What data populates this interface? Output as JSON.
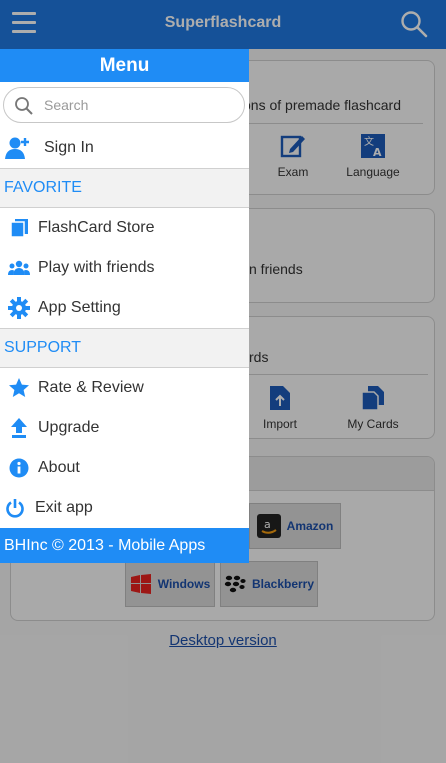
{
  "topbar": {
    "title": "Superflashcard"
  },
  "background": {
    "card1_text": "ons of premade flashcard",
    "card1_buttons": [
      {
        "label": "Exam",
        "icon": "edit-icon"
      },
      {
        "label": "Language",
        "icon": "translate-icon"
      }
    ],
    "card2_text": "n friends",
    "card3_text": "rds",
    "card3_buttons": [
      {
        "label": "Import",
        "icon": "file-upload-icon"
      },
      {
        "label": "My Cards",
        "icon": "cards-icon"
      }
    ],
    "stores": [
      {
        "label": "Amazon",
        "icon": "amazon-icon"
      },
      {
        "label": "Windows",
        "icon": "windows-icon"
      },
      {
        "label": "Blackberry",
        "icon": "blackberry-icon"
      }
    ],
    "desktop_link": "Desktop version"
  },
  "menu": {
    "title": "Menu",
    "search_placeholder": "Search",
    "sign_in": "Sign In",
    "favorite_header": "FAVORITE",
    "favorite_items": [
      {
        "label": "FlashCard Store",
        "icon": "cards-icon"
      },
      {
        "label": "Play with friends",
        "icon": "group-icon"
      },
      {
        "label": "App Setting",
        "icon": "gear-icon"
      }
    ],
    "support_header": "SUPPORT",
    "support_items": [
      {
        "label": "Rate & Review",
        "icon": "star-icon"
      },
      {
        "label": "Upgrade",
        "icon": "upload-arrow-icon"
      },
      {
        "label": "About",
        "icon": "info-icon"
      },
      {
        "label": "Exit app",
        "icon": "power-icon"
      }
    ],
    "footer": "BHInc © 2013 - Mobile Apps"
  },
  "colors": {
    "accent": "#1f8cf5",
    "topbar": "#1f78e0",
    "link": "#1d4fa8"
  }
}
